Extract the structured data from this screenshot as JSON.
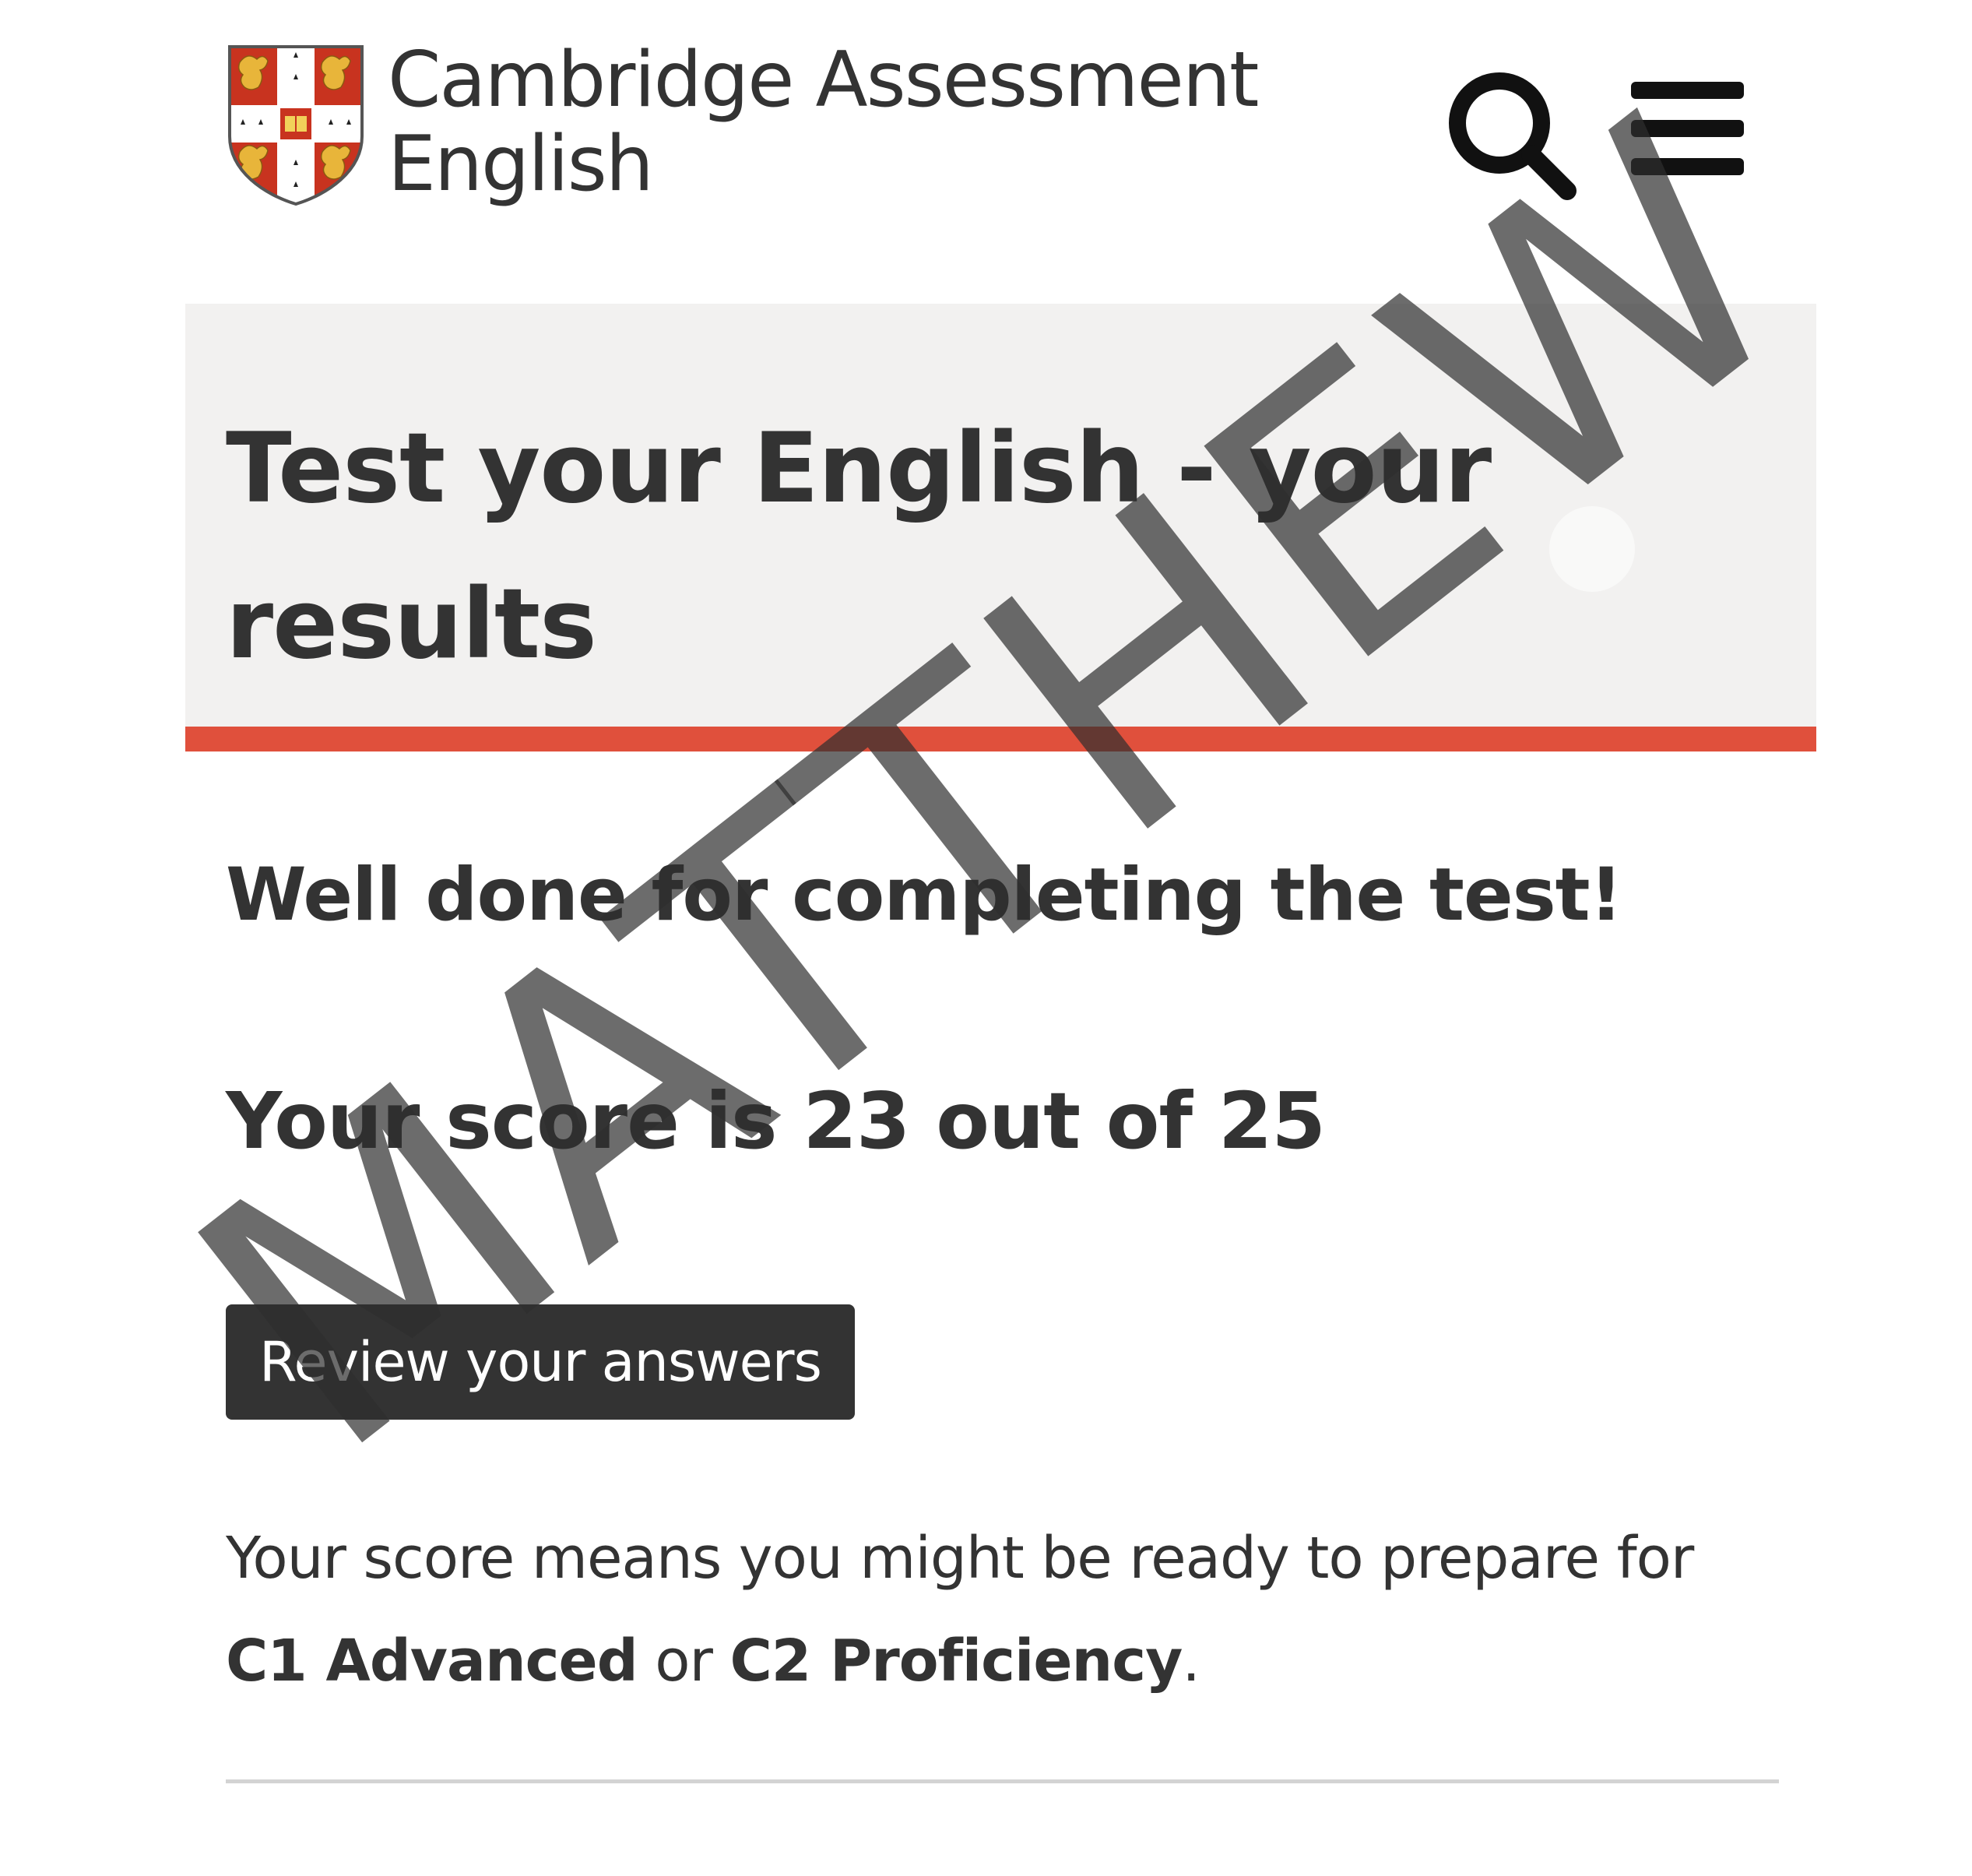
{
  "header": {
    "logo_line1": "Cambridge Assessment",
    "logo_line2": "English",
    "search_icon": "search-icon",
    "menu_icon": "hamburger-menu-icon"
  },
  "banner": {
    "title": "Test your English - your results",
    "accent_color": "#e0503c",
    "background_color": "#f2f1f0"
  },
  "results": {
    "well_done": "Well done for completing the test!",
    "score_text": "Your score is 23 out of 25",
    "score": 23,
    "score_max": 25,
    "review_button_label": "Review your answers",
    "info_prefix": "Your score means you might be ready to prepare for",
    "exam_1": "C1 Advanced",
    "info_joiner": "or",
    "exam_2": "C2 Proficiency",
    "info_suffix": "."
  },
  "watermark": {
    "text": "MATTHEW"
  }
}
